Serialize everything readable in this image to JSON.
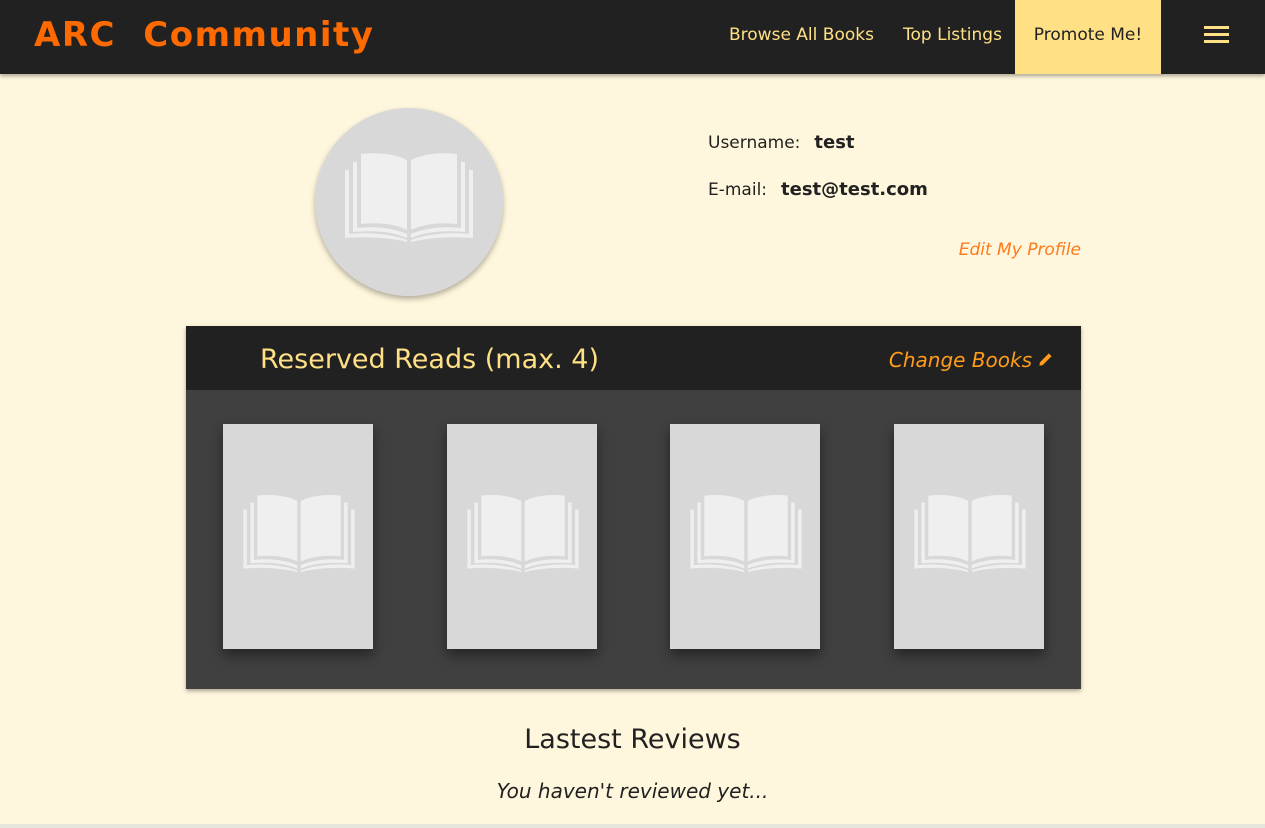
{
  "navbar": {
    "brand": "ARC Community",
    "links": [
      "Browse All Books",
      "Top Listings"
    ],
    "promote_label": "Promote Me!",
    "menu_icon": "hamburger-menu-icon"
  },
  "profile": {
    "avatar_icon": "book-placeholder-icon",
    "username_label": "Username:",
    "username": "test",
    "email_label": "E-mail:",
    "email": "test@test.com",
    "edit_label": "Edit My Profile"
  },
  "reserved": {
    "title": "Reserved Reads (max. 4)",
    "change_label": "Change Books",
    "change_icon": "pencil-icon",
    "books": [
      {
        "cover": "book-placeholder-icon"
      },
      {
        "cover": "book-placeholder-icon"
      },
      {
        "cover": "book-placeholder-icon"
      },
      {
        "cover": "book-placeholder-icon"
      }
    ]
  },
  "reviews": {
    "title": "Lastest Reviews",
    "empty_text": "You haven't reviewed yet..."
  },
  "colors": {
    "background": "#fff7dd",
    "navbar": "#212121",
    "brand": "#ff6a00",
    "nav_text": "#ffe085",
    "accent": "#ff9c1a",
    "panel": "#404040",
    "placeholder": "#d8d8d8"
  }
}
